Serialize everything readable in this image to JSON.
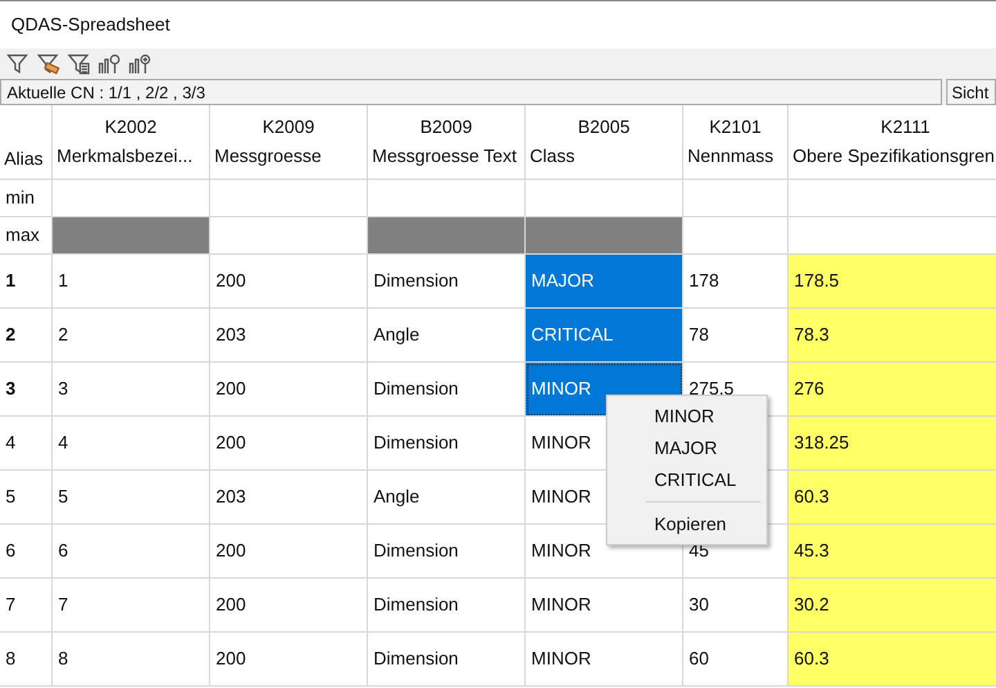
{
  "window": {
    "title": "QDAS-Spreadsheet"
  },
  "toolbar": {
    "buttons": [
      {
        "kind": "filter"
      },
      {
        "kind": "filter-clear"
      },
      {
        "kind": "filter-list"
      },
      {
        "kind": "chart-search"
      },
      {
        "kind": "chart-add"
      }
    ]
  },
  "status_bar": {
    "text": "Aktuelle CN : 1/1 , 2/2 , 3/3",
    "button": "Sicht"
  },
  "table": {
    "alias_label": "Alias",
    "min_label": "min",
    "max_label": "max",
    "columns": [
      {
        "code": "K2002",
        "name": "Merkmalsbezei...",
        "max_filled": true,
        "highlighted": false,
        "selected": false
      },
      {
        "code": "K2009",
        "name": "Messgroesse",
        "max_filled": false,
        "highlighted": false,
        "selected": false
      },
      {
        "code": "B2009",
        "name": "Messgroesse Text",
        "max_filled": true,
        "highlighted": false,
        "selected": false
      },
      {
        "code": "B2005",
        "name": "Class",
        "max_filled": true,
        "highlighted": false,
        "selected": true
      },
      {
        "code": "K2101",
        "name": "Nennmass",
        "max_filled": false,
        "highlighted": false,
        "selected": false
      },
      {
        "code": "K2111",
        "name": "Obere Spezifikationsgren",
        "max_filled": false,
        "highlighted": true,
        "selected": false
      }
    ],
    "rows": [
      {
        "number": "1",
        "selected": true,
        "cells": [
          "1",
          "200",
          "Dimension",
          "MAJOR",
          "178",
          "178.5"
        ]
      },
      {
        "number": "2",
        "selected": true,
        "cells": [
          "2",
          "203",
          "Angle",
          "CRITICAL",
          "78",
          "78.3"
        ]
      },
      {
        "number": "3",
        "selected": true,
        "focused": true,
        "cells": [
          "3",
          "200",
          "Dimension",
          "MINOR",
          "275.5",
          "276"
        ]
      },
      {
        "number": "4",
        "selected": false,
        "cells": [
          "4",
          "200",
          "Dimension",
          "MINOR",
          "",
          "318.25"
        ]
      },
      {
        "number": "5",
        "selected": false,
        "cells": [
          "5",
          "203",
          "Angle",
          "MINOR",
          "",
          "60.3"
        ]
      },
      {
        "number": "6",
        "selected": false,
        "cells": [
          "6",
          "200",
          "Dimension",
          "MINOR",
          "45",
          "45.3"
        ]
      },
      {
        "number": "7",
        "selected": false,
        "cells": [
          "7",
          "200",
          "Dimension",
          "MINOR",
          "30",
          "30.2"
        ]
      },
      {
        "number": "8",
        "selected": false,
        "cells": [
          "8",
          "200",
          "Dimension",
          "MINOR",
          "60",
          "60.3"
        ]
      }
    ]
  },
  "context_menu": {
    "items": [
      {
        "kind": "item",
        "label": "MINOR"
      },
      {
        "kind": "item",
        "label": "MAJOR"
      },
      {
        "kind": "item",
        "label": "CRITICAL"
      },
      {
        "kind": "separator"
      },
      {
        "kind": "item",
        "label": "Kopieren"
      }
    ]
  }
}
